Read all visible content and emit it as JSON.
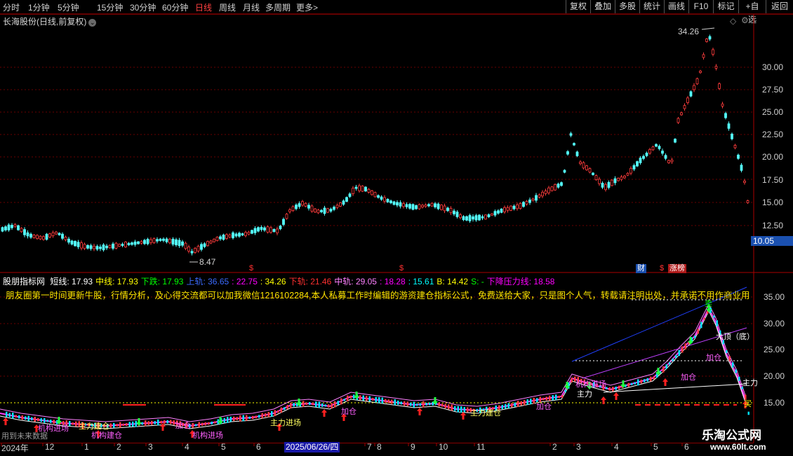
{
  "periods": [
    "分时",
    "1分钟",
    "5分钟",
    "15分钟",
    "30分钟",
    "60分钟",
    "日线",
    "周线",
    "月线",
    "多周期",
    "更多"
  ],
  "more_arrow": ">",
  "toolbar_buttons": [
    "复权",
    "叠加",
    "多股",
    "统计",
    "画线",
    "F10",
    "标记",
    "+自选",
    "返回"
  ],
  "title": "长海股份(日线,前复权)",
  "title_chev": "⌄",
  "diamond_icon": "◇",
  "gear_icon": "⚙",
  "high_price_label": "34.26",
  "low_price_label": "8.47",
  "current_price": "10.05",
  "price_axis_labels": [
    "30.00",
    "27.50",
    "25.00",
    "22.50",
    "20.00",
    "17.50",
    "15.00",
    "12.50"
  ],
  "event_markers": {
    "s_glyph": "$",
    "cai": "财",
    "zhangbang": "涨榜"
  },
  "indicator": {
    "name": "股朋指标网",
    "items": [
      {
        "label": "短线:",
        "value": "17.93",
        "color": "#ffffff"
      },
      {
        "label": "中线:",
        "value": "17.93",
        "color": "#ffff00"
      },
      {
        "label": "下跌:",
        "value": "17.93",
        "color": "#00ff00"
      },
      {
        "label": "上轨:",
        "value": "36.65",
        "color": "#3b6bff"
      },
      {
        "label": ":",
        "value": "22.75",
        "color": "#ff00ff"
      },
      {
        "label": ":",
        "value": "34.26",
        "color": "#ffff00"
      },
      {
        "label": "下轨:",
        "value": "21.46",
        "color": "#ff3030"
      },
      {
        "label": "中轨:",
        "value": "29.05",
        "color": "#ff80ff"
      },
      {
        "label": ":",
        "value": "18.28",
        "color": "#ff00ff"
      },
      {
        "label": ":",
        "value": "15.61",
        "color": "#00ffff"
      },
      {
        "label": "B:",
        "value": "14.42",
        "color": "#ffff00"
      },
      {
        "label": "S:",
        "value": "-",
        "color": "#00ff00"
      },
      {
        "label": "下降压力线:",
        "value": "18.58",
        "color": "#ff00ff"
      }
    ],
    "description": "朋友圈第一时间更新牛股，行情分析，及心得交流都可以加我微信1216102284,本人私募工作时编辑的游资建仓指标公式，免费送给大家，只是图个人气，转载请注明出处，并承诺不用作商业用途"
  },
  "indicator_axis_labels": [
    "35.00",
    "30.00",
    "25.00",
    "20.00",
    "15.00"
  ],
  "signal_labels": [
    "机构进场",
    "主力建仓",
    "加仓",
    "主力进场",
    "机构进场",
    "机构建仓",
    "加仓",
    "主力建仓",
    "加仓",
    "机构进场",
    "主力",
    "加仓",
    "加仓",
    "大顶（底）",
    "主力",
    "卖",
    "买"
  ],
  "date_labels": [
    "2024年",
    "12",
    "1",
    "2",
    "3",
    "4",
    "5",
    "6",
    "7",
    "8",
    "9",
    "10",
    "11",
    "12",
    "2",
    "3",
    "4",
    "5",
    "6"
  ],
  "cursor_date": "2025/06/26/四",
  "future_note": "用到未来数据",
  "watermark": "乐淘公式网",
  "watermark_url": "www.60lt.com"
}
